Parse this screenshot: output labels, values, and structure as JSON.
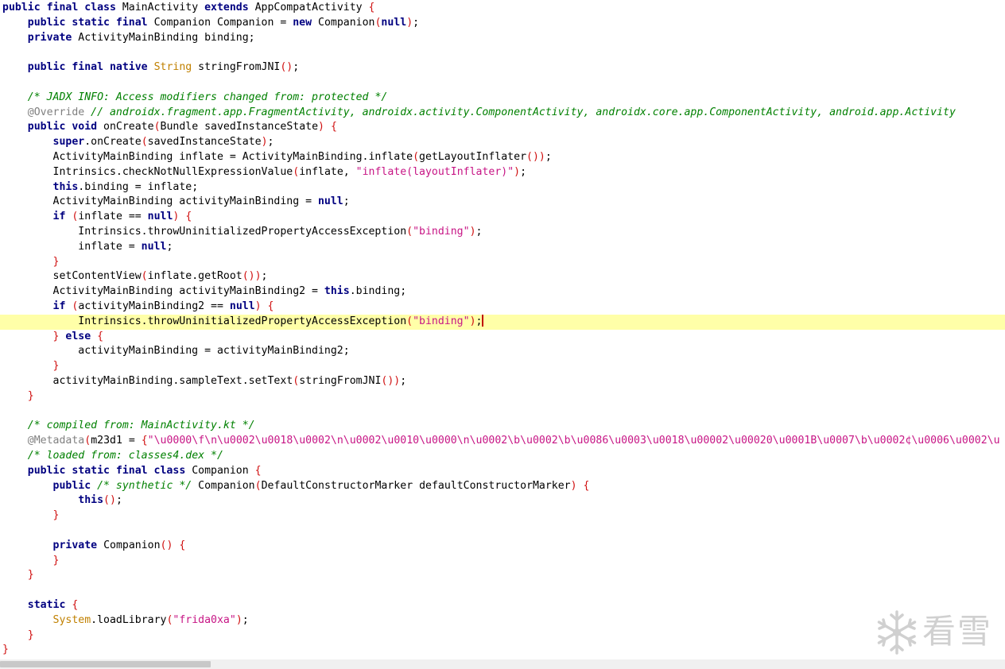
{
  "editor": {
    "lines": [
      [
        [
          "kw",
          "public final class "
        ],
        [
          "p",
          "MainActivity "
        ],
        [
          "kw",
          "extends "
        ],
        [
          "p",
          "AppCompatActivity "
        ],
        [
          "br",
          "{"
        ]
      ],
      [
        [
          "p",
          "    "
        ],
        [
          "kw",
          "public static final "
        ],
        [
          "p",
          "Companion Companion = "
        ],
        [
          "kw",
          "new "
        ],
        [
          "p",
          "Companion"
        ],
        [
          "br",
          "("
        ],
        [
          "kw",
          "null"
        ],
        [
          "br",
          ")"
        ],
        [
          "p",
          ";"
        ]
      ],
      [
        [
          "p",
          "    "
        ],
        [
          "kw",
          "private "
        ],
        [
          "p",
          "ActivityMainBinding binding;"
        ]
      ],
      [],
      [
        [
          "p",
          "    "
        ],
        [
          "kw",
          "public final native "
        ],
        [
          "ty",
          "String "
        ],
        [
          "p",
          "stringFromJNI"
        ],
        [
          "br",
          "()"
        ],
        [
          "p",
          ";"
        ]
      ],
      [],
      [
        [
          "p",
          "    "
        ],
        [
          "cm",
          "/* JADX INFO: Access modifiers changed from: protected */"
        ]
      ],
      [
        [
          "p",
          "    "
        ],
        [
          "ann",
          "@Override "
        ],
        [
          "cm",
          "// androidx.fragment.app.FragmentActivity, androidx.activity.ComponentActivity, androidx.core.app.ComponentActivity, android.app.Activity"
        ]
      ],
      [
        [
          "p",
          "    "
        ],
        [
          "kw",
          "public void "
        ],
        [
          "p",
          "onCreate"
        ],
        [
          "br",
          "("
        ],
        [
          "p",
          "Bundle savedInstanceState"
        ],
        [
          "br",
          ")"
        ],
        [
          "p",
          " "
        ],
        [
          "br",
          "{"
        ]
      ],
      [
        [
          "p",
          "        "
        ],
        [
          "kw",
          "super"
        ],
        [
          "p",
          ".onCreate"
        ],
        [
          "br",
          "("
        ],
        [
          "p",
          "savedInstanceState"
        ],
        [
          "br",
          ")"
        ],
        [
          "p",
          ";"
        ]
      ],
      [
        [
          "p",
          "        ActivityMainBinding inflate = ActivityMainBinding.inflate"
        ],
        [
          "br",
          "("
        ],
        [
          "p",
          "getLayoutInflater"
        ],
        [
          "br",
          "())"
        ],
        [
          "p",
          ";"
        ]
      ],
      [
        [
          "p",
          "        Intrinsics.checkNotNullExpressionValue"
        ],
        [
          "br",
          "("
        ],
        [
          "p",
          "inflate, "
        ],
        [
          "str",
          "\"inflate(layoutInflater)\""
        ],
        [
          "br",
          ")"
        ],
        [
          "p",
          ";"
        ]
      ],
      [
        [
          "p",
          "        "
        ],
        [
          "kw",
          "this"
        ],
        [
          "p",
          ".binding = inflate;"
        ]
      ],
      [
        [
          "p",
          "        ActivityMainBinding activityMainBinding = "
        ],
        [
          "kw",
          "null"
        ],
        [
          "p",
          ";"
        ]
      ],
      [
        [
          "p",
          "        "
        ],
        [
          "kw",
          "if "
        ],
        [
          "br",
          "("
        ],
        [
          "p",
          "inflate == "
        ],
        [
          "kw",
          "null"
        ],
        [
          "br",
          ")"
        ],
        [
          "p",
          " "
        ],
        [
          "br",
          "{"
        ]
      ],
      [
        [
          "p",
          "            Intrinsics.throwUninitializedPropertyAccessException"
        ],
        [
          "br",
          "("
        ],
        [
          "str",
          "\"binding\""
        ],
        [
          "br",
          ")"
        ],
        [
          "p",
          ";"
        ]
      ],
      [
        [
          "p",
          "            inflate = "
        ],
        [
          "kw",
          "null"
        ],
        [
          "p",
          ";"
        ]
      ],
      [
        [
          "p",
          "        "
        ],
        [
          "br",
          "}"
        ]
      ],
      [
        [
          "p",
          "        setContentView"
        ],
        [
          "br",
          "("
        ],
        [
          "p",
          "inflate.getRoot"
        ],
        [
          "br",
          "())"
        ],
        [
          "p",
          ";"
        ]
      ],
      [
        [
          "p",
          "        ActivityMainBinding activityMainBinding2 = "
        ],
        [
          "kw",
          "this"
        ],
        [
          "p",
          ".binding;"
        ]
      ],
      [
        [
          "p",
          "        "
        ],
        [
          "kw",
          "if "
        ],
        [
          "br",
          "("
        ],
        [
          "p",
          "activityMainBinding2 == "
        ],
        [
          "kw",
          "null"
        ],
        [
          "br",
          ")"
        ],
        [
          "p",
          " "
        ],
        [
          "br",
          "{"
        ]
      ],
      [
        [
          "p",
          "            Intrinsics.throwUninitializedPropertyAccessException"
        ],
        [
          "br",
          "("
        ],
        [
          "str",
          "\"binding\""
        ],
        [
          "br",
          ")"
        ],
        [
          "p",
          ";"
        ]
      ],
      [
        [
          "p",
          "        "
        ],
        [
          "br",
          "} "
        ],
        [
          "kw",
          "else "
        ],
        [
          "br",
          "{"
        ]
      ],
      [
        [
          "p",
          "            activityMainBinding = activityMainBinding2;"
        ]
      ],
      [
        [
          "p",
          "        "
        ],
        [
          "br",
          "}"
        ]
      ],
      [
        [
          "p",
          "        activityMainBinding.sampleText.setText"
        ],
        [
          "br",
          "("
        ],
        [
          "p",
          "stringFromJNI"
        ],
        [
          "br",
          "())"
        ],
        [
          "p",
          ";"
        ]
      ],
      [
        [
          "p",
          "    "
        ],
        [
          "br",
          "}"
        ]
      ],
      [],
      [
        [
          "p",
          "    "
        ],
        [
          "cm",
          "/* compiled from: MainActivity.kt */"
        ]
      ],
      [
        [
          "p",
          "    "
        ],
        [
          "ann",
          "@Metadata"
        ],
        [
          "br",
          "("
        ],
        [
          "p",
          "m23d1 = "
        ],
        [
          "br",
          "{"
        ],
        [
          "str",
          "\"\\u0000\\f\\n\\u0002\\u0018\\u0002\\n\\u0002\\u0010\\u0000\\n\\u0002\\b\\u0002\\b\\u0086\\u0003\\u0018\\u00002\\u00020\\u0001B\\u0007\\b\\u0002¢\\u0006\\u0002\\u"
        ]
      ],
      [
        [
          "p",
          "    "
        ],
        [
          "cm",
          "/* loaded from: classes4.dex */"
        ]
      ],
      [
        [
          "p",
          "    "
        ],
        [
          "kw",
          "public static final class "
        ],
        [
          "p",
          "Companion "
        ],
        [
          "br",
          "{"
        ]
      ],
      [
        [
          "p",
          "        "
        ],
        [
          "kw",
          "public "
        ],
        [
          "cm",
          "/* synthetic */ "
        ],
        [
          "p",
          "Companion"
        ],
        [
          "br",
          "("
        ],
        [
          "p",
          "DefaultConstructorMarker defaultConstructorMarker"
        ],
        [
          "br",
          ")"
        ],
        [
          "p",
          " "
        ],
        [
          "br",
          "{"
        ]
      ],
      [
        [
          "p",
          "            "
        ],
        [
          "kw",
          "this"
        ],
        [
          "br",
          "()"
        ],
        [
          "p",
          ";"
        ]
      ],
      [
        [
          "p",
          "        "
        ],
        [
          "br",
          "}"
        ]
      ],
      [],
      [
        [
          "p",
          "        "
        ],
        [
          "kw",
          "private "
        ],
        [
          "p",
          "Companion"
        ],
        [
          "br",
          "()"
        ],
        [
          "p",
          " "
        ],
        [
          "br",
          "{"
        ]
      ],
      [
        [
          "p",
          "        "
        ],
        [
          "br",
          "}"
        ]
      ],
      [
        [
          "p",
          "    "
        ],
        [
          "br",
          "}"
        ]
      ],
      [],
      [
        [
          "p",
          "    "
        ],
        [
          "kw",
          "static "
        ],
        [
          "br",
          "{"
        ]
      ],
      [
        [
          "p",
          "        "
        ],
        [
          "ty",
          "System"
        ],
        [
          "p",
          ".loadLibrary"
        ],
        [
          "br",
          "("
        ],
        [
          "str",
          "\"frida0xa\""
        ],
        [
          "br",
          ")"
        ],
        [
          "p",
          ";"
        ]
      ],
      [
        [
          "p",
          "    "
        ],
        [
          "br",
          "}"
        ]
      ],
      [
        [
          "br",
          "}"
        ]
      ]
    ],
    "current_line_index": 21
  },
  "scrollbar": {
    "horizontal_position": 0.21
  },
  "watermark": {
    "text": "看雪",
    "icon": "snowflake-icon",
    "color": "#d0d0d0"
  },
  "colors": {
    "keyword": "#000080",
    "comment": "#008000",
    "string": "#c71585",
    "annotation": "#808080",
    "type": "#c08000",
    "bracket": "#d01010",
    "current_line": "#ffffa8",
    "caret": "#c00000"
  }
}
